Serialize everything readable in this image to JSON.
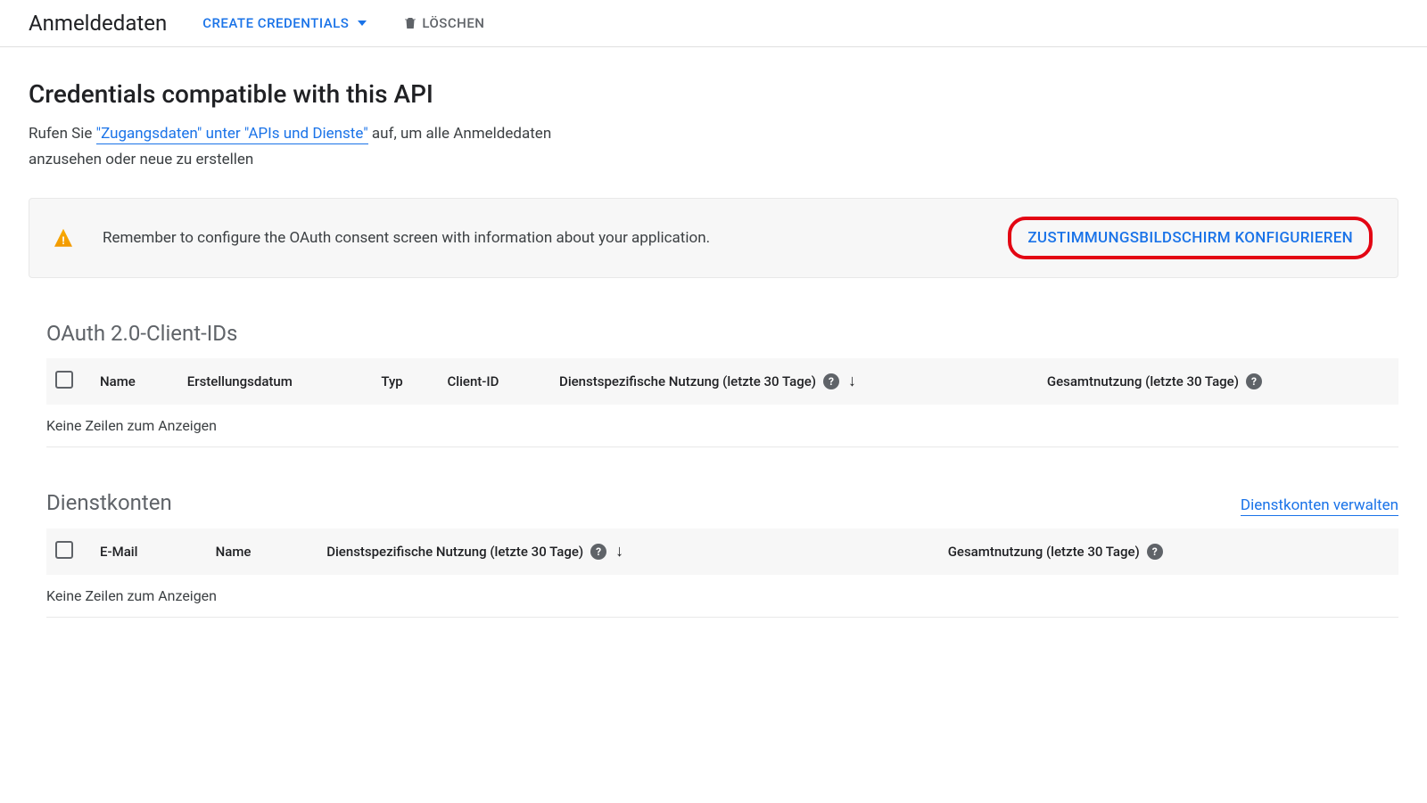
{
  "toolbar": {
    "title": "Anmeldedaten",
    "create_label": "CREATE CREDENTIALS",
    "delete_label": "LÖSCHEN"
  },
  "main": {
    "heading": "Credentials compatible with this API",
    "intro_prefix": "Rufen Sie ",
    "intro_link": "\"Zugangsdaten\" unter \"APIs und Dienste\"",
    "intro_suffix": " auf, um alle Anmeldedaten anzusehen oder neue zu erstellen"
  },
  "alert": {
    "text": "Remember to configure the OAuth consent screen with information about your application.",
    "action_label": "ZUSTIMMUNGSBILDSCHIRM KONFIGURIEREN"
  },
  "oauth_section": {
    "heading": "OAuth 2.0-Client-IDs",
    "columns": {
      "name": "Name",
      "created": "Erstellungsdatum",
      "type": "Typ",
      "client_id": "Client-ID",
      "service_usage": "Dienstspezifische Nutzung (letzte 30 Tage)",
      "total_usage": "Gesamtnutzung (letzte 30 Tage)"
    },
    "empty": "Keine Zeilen zum Anzeigen"
  },
  "service_section": {
    "heading": "Dienstkonten",
    "manage_link": "Dienstkonten verwalten",
    "columns": {
      "email": "E-Mail",
      "name": "Name",
      "service_usage": "Dienstspezifische Nutzung (letzte 30 Tage)",
      "total_usage": "Gesamtnutzung (letzte 30 Tage)"
    },
    "empty": "Keine Zeilen zum Anzeigen"
  }
}
